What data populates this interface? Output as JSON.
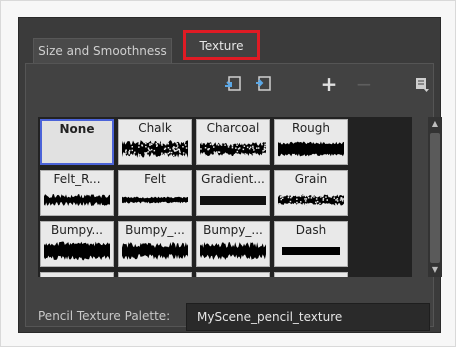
{
  "tabs": [
    {
      "label": "Size and Smoothness"
    },
    {
      "label": "Texture"
    }
  ],
  "toolbar": {
    "import_icon": "import-texture-icon",
    "export_icon": "export-texture-icon",
    "add_label": "+",
    "remove_label": "−",
    "menu_icon": "menu-icon"
  },
  "textures": [
    {
      "name": "None",
      "pattern": "none",
      "selected": true
    },
    {
      "name": "Chalk",
      "pattern": "chalk"
    },
    {
      "name": "Charcoal",
      "pattern": "charcoal"
    },
    {
      "name": "Rough",
      "pattern": "rough"
    },
    {
      "name": "Felt_R...",
      "pattern": "felt-r"
    },
    {
      "name": "Felt",
      "pattern": "felt"
    },
    {
      "name": "Gradient...",
      "pattern": "gradient"
    },
    {
      "name": "Grain",
      "pattern": "grain"
    },
    {
      "name": "Bumpy...",
      "pattern": "bumpy"
    },
    {
      "name": "Bumpy_...",
      "pattern": "bumpy2"
    },
    {
      "name": "Bumpy_...",
      "pattern": "bumpy3"
    },
    {
      "name": "Dash",
      "pattern": "dash"
    }
  ],
  "palette": {
    "label": "Pencil Texture Palette:",
    "value": "MyScene_pencil_texture"
  },
  "colors": {
    "highlight": "#e01b24",
    "selection": "#4b63d8"
  }
}
